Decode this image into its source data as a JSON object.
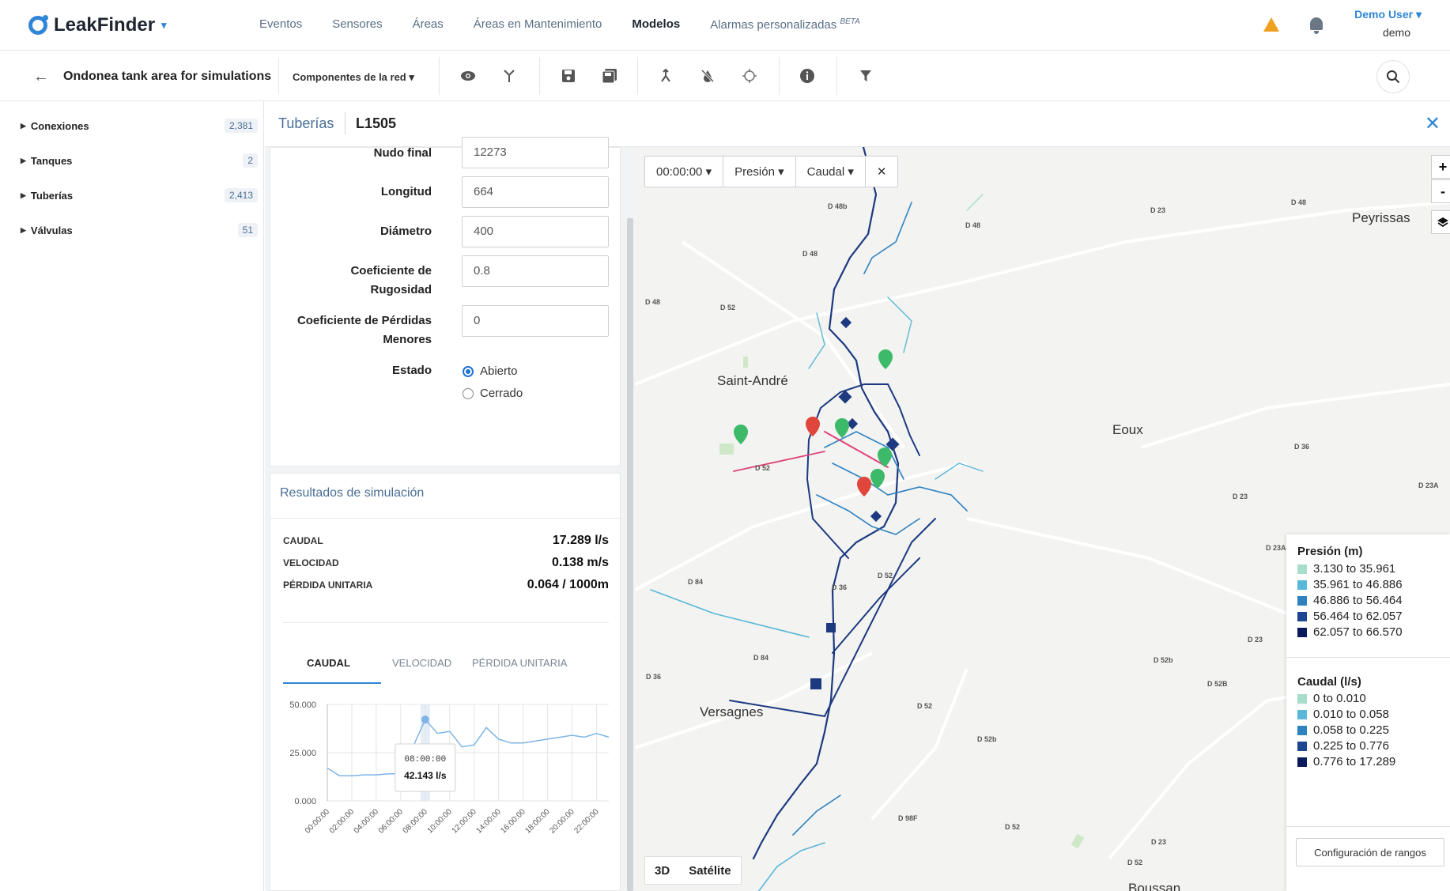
{
  "app": {
    "name": "LeakFinder"
  },
  "nav": {
    "items": [
      "Eventos",
      "Sensores",
      "Áreas",
      "Áreas en Mantenimiento",
      "Modelos",
      "Alarmas personalizadas"
    ],
    "beta_tag": "BETA"
  },
  "user": {
    "name": "Demo User",
    "login": "demo"
  },
  "toolbar": {
    "model_title": "Ondonea tank area for simulations",
    "components_label": "Componentes de la red"
  },
  "sidebar": {
    "items": [
      {
        "label": "Conexiones",
        "count": "2,381"
      },
      {
        "label": "Tanques",
        "count": "2"
      },
      {
        "label": "Tuberías",
        "count": "2,413"
      },
      {
        "label": "Válvulas",
        "count": "51"
      }
    ]
  },
  "panel": {
    "type": "Tuberías",
    "id": "L1505"
  },
  "form": {
    "nudo_final": {
      "label": "Nudo final",
      "value": "12273"
    },
    "longitud": {
      "label": "Longitud",
      "value": "664"
    },
    "diametro": {
      "label": "Diámetro",
      "value": "400"
    },
    "rugosidad": {
      "label_1": "Coeficiente de",
      "label_2": "Rugosidad",
      "value": "0.8"
    },
    "perdidas": {
      "label_1": "Coeficiente de Pérdidas",
      "label_2": "Menores",
      "value": "0"
    },
    "estado": {
      "label": "Estado",
      "option_open": "Abierto",
      "option_closed": "Cerrado",
      "selected": "Abierto"
    }
  },
  "results": {
    "title": "Resultados de simulación",
    "rows": [
      {
        "label": "CAUDAL",
        "value": "17.289 l/s"
      },
      {
        "label": "VELOCIDAD",
        "value": "0.138 m/s"
      },
      {
        "label": "PÉRDIDA UNITARIA",
        "value": "0.064 / 1000m"
      }
    ],
    "tabs": [
      "CAUDAL",
      "VELOCIDAD",
      "PÉRDIDA UNITARIA"
    ],
    "active_tab": "CAUDAL",
    "tooltip": {
      "time": "08:00:00",
      "value": "42.143 l/s"
    }
  },
  "chart_data": {
    "type": "line",
    "x": [
      "00:00:00",
      "01:00:00",
      "02:00:00",
      "03:00:00",
      "04:00:00",
      "05:00:00",
      "06:00:00",
      "07:00:00",
      "08:00:00",
      "09:00:00",
      "10:00:00",
      "11:00:00",
      "12:00:00",
      "13:00:00",
      "14:00:00",
      "15:00:00",
      "16:00:00",
      "17:00:00",
      "18:00:00",
      "19:00:00",
      "20:00:00",
      "21:00:00",
      "22:00:00",
      "23:00:00"
    ],
    "xticks": [
      "00:00:00",
      "02:00:00",
      "04:00:00",
      "06:00:00",
      "08:00:00",
      "10:00:00",
      "12:00:00",
      "14:00:00",
      "16:00:00",
      "18:00:00",
      "20:00:00",
      "22:00:00"
    ],
    "y": [
      17,
      13,
      13,
      13.5,
      13.5,
      14,
      14,
      28,
      42.143,
      35,
      36,
      28,
      29,
      38,
      32,
      30,
      30,
      31,
      32,
      33,
      34,
      33,
      35,
      33
    ],
    "ylim": [
      0,
      50
    ],
    "yticks": [
      "0.000",
      "25.000",
      "50.000"
    ],
    "highlight_index": 8,
    "color": "#7fb4e6"
  },
  "map": {
    "time_select": "00:00:00",
    "pressure_select": "Presión",
    "flow_select": "Caudal",
    "places": [
      "Saint-André",
      "Eoux",
      "Peyrissas",
      "Versagnes",
      "Boussan"
    ],
    "roads": [
      "D 48b",
      "D 48",
      "D 48",
      "D 48",
      "D 52",
      "D 23",
      "D 48",
      "D 36",
      "D 23",
      "D 23A",
      "D 52",
      "D 84",
      "D 36",
      "D 52",
      "D 23A",
      "D 84",
      "D 52b",
      "D 52B",
      "D 23",
      "D 36",
      "D 52",
      "D 52b",
      "D 98F",
      "D 52",
      "D 23",
      "D 52"
    ],
    "view_3d": "3D",
    "view_satellite": "Satélite",
    "legend": {
      "pressure_title": "Presión (m)",
      "pressure_ranges": [
        {
          "label": "3.130 to 35.961",
          "color": "#a8dccb"
        },
        {
          "label": "35.961 to 46.886",
          "color": "#5ab8d8"
        },
        {
          "label": "46.886 to 56.464",
          "color": "#2e82c0"
        },
        {
          "label": "56.464 to 62.057",
          "color": "#1d4592"
        },
        {
          "label": "62.057 to 66.570",
          "color": "#0b1a5a"
        }
      ],
      "flow_title": "Caudal (l/s)",
      "flow_ranges": [
        {
          "label": "0 to 0.010",
          "color": "#a8dccb"
        },
        {
          "label": "0.010 to 0.058",
          "color": "#5ab8d8"
        },
        {
          "label": "0.058 to 0.225",
          "color": "#2e82c0"
        },
        {
          "label": "0.225 to 0.776",
          "color": "#1d4592"
        },
        {
          "label": "0.776 to 17.289",
          "color": "#0b1a5a"
        }
      ],
      "config_button": "Configuración de rangos"
    }
  }
}
